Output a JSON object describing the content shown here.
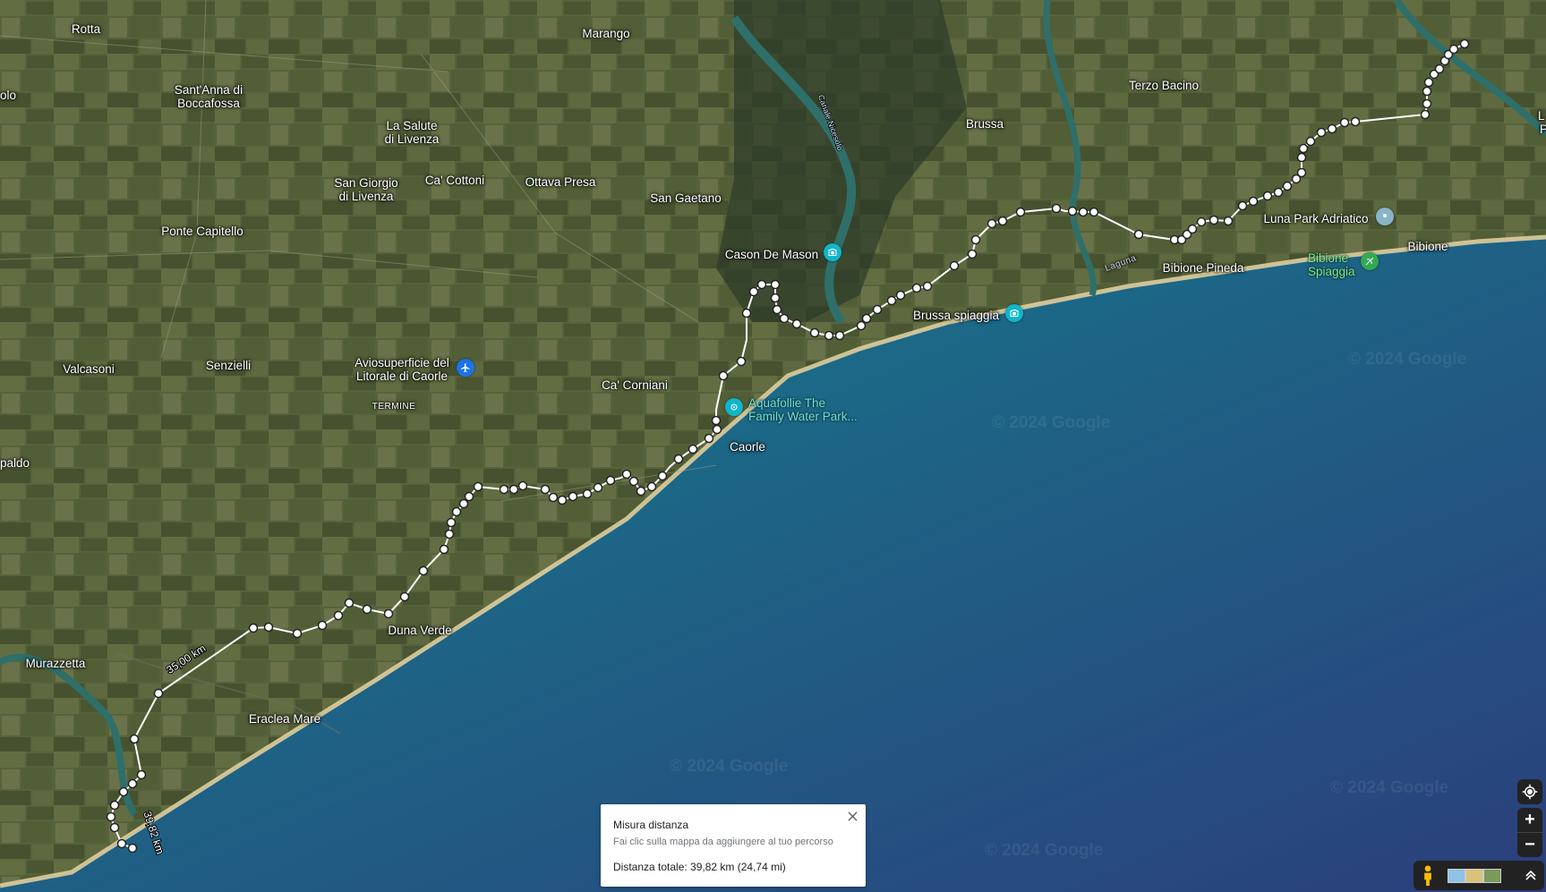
{
  "map": {
    "places": [
      {
        "id": "rotta",
        "text": "Rotta"
      },
      {
        "id": "olo",
        "text": "olo"
      },
      {
        "id": "santanna",
        "text": "Sant'Anna di\nBoccafossa"
      },
      {
        "id": "marango",
        "text": "Marango"
      },
      {
        "id": "salute",
        "text": "La Salute\ndi Livenza"
      },
      {
        "id": "sangiorgio",
        "text": "San Giorgio\ndi Livenza"
      },
      {
        "id": "cacottoni",
        "text": "Ca' Cottoni"
      },
      {
        "id": "ottava",
        "text": "Ottava Presa"
      },
      {
        "id": "sangaetano",
        "text": "San Gaetano"
      },
      {
        "id": "pontecapitello",
        "text": "Ponte Capitello"
      },
      {
        "id": "valcasoni",
        "text": "Valcasoni"
      },
      {
        "id": "senzielli",
        "text": "Senzielli"
      },
      {
        "id": "aviosuperficie",
        "text": "Aviosuperficie del\nLitorale di Caorle"
      },
      {
        "id": "termine",
        "text": "TERMINE"
      },
      {
        "id": "cacorniani",
        "text": "Ca' Corniani"
      },
      {
        "id": "paldo",
        "text": "paldo"
      },
      {
        "id": "cason",
        "text": "Cason De Mason"
      },
      {
        "id": "aquafollie",
        "text": "Aquafollie The\nFamily Water Park..."
      },
      {
        "id": "caorle",
        "text": "Caorle"
      },
      {
        "id": "brussa",
        "text": "Brussa"
      },
      {
        "id": "terzobacino",
        "text": "Terzo Bacino"
      },
      {
        "id": "brussaspiaggia",
        "text": "Brussa spiaggia"
      },
      {
        "id": "laguna",
        "text": "Laguna"
      },
      {
        "id": "bibionepineda",
        "text": "Bibione Pineda"
      },
      {
        "id": "lunapark",
        "text": "Luna Park Adriatico"
      },
      {
        "id": "bibione",
        "text": "Bibione"
      },
      {
        "id": "bibionespiaggia",
        "text": "Bibione\nSpiaggia"
      },
      {
        "id": "canale",
        "text": "Canale Nicesolo"
      },
      {
        "id": "murazzetta",
        "text": "Murazzetta"
      },
      {
        "id": "dunaverde",
        "text": "Duna Verde"
      },
      {
        "id": "eraclea",
        "text": "Eraclea Mare"
      },
      {
        "id": "edge_l",
        "text": "L"
      },
      {
        "id": "edge_p",
        "text": "P"
      }
    ],
    "route_labels": {
      "segment": "35,00 km",
      "total": "39,82 km"
    },
    "watermark": "© 2024 Google"
  },
  "measure": {
    "title": "Misura distanza",
    "hint": "Fai clic sulla mappa da aggiungere al tuo percorso",
    "total": "Distanza totale: 39,82 km (24,74 mi)"
  },
  "controls": {
    "locate": "location-icon",
    "zoom_in": "+",
    "zoom_out": "−",
    "pegman": "pegman-icon",
    "expand": "chevron-up-icon"
  }
}
